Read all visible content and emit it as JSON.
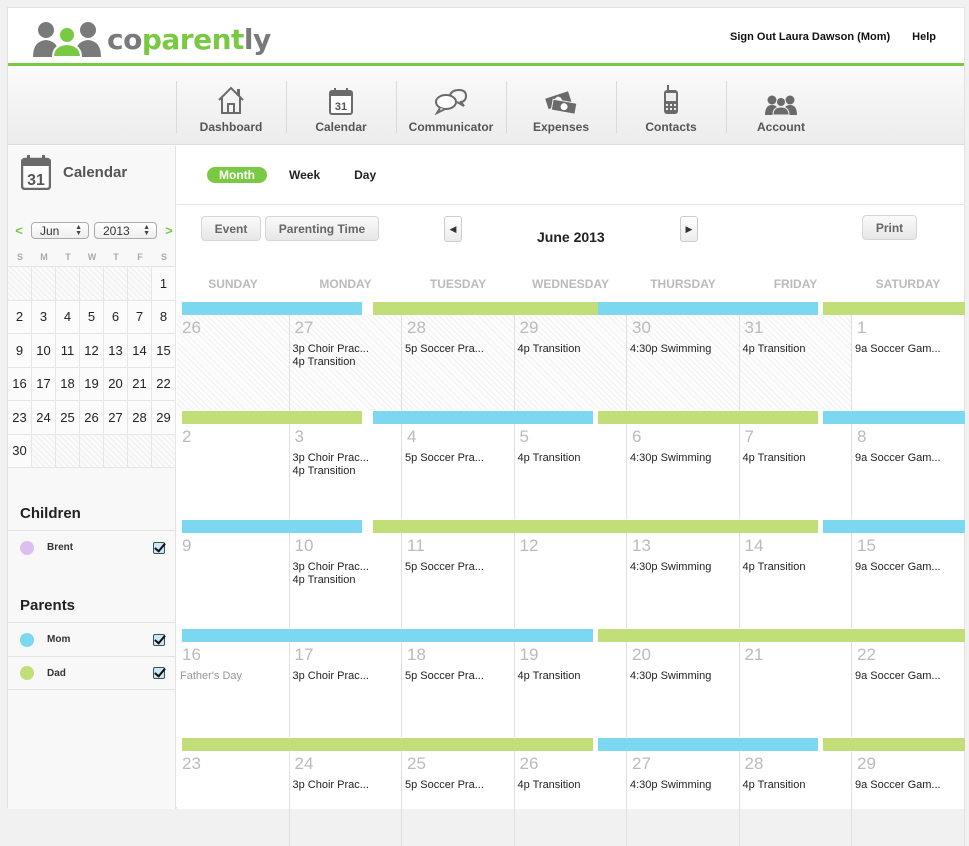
{
  "app": {
    "logo_part1": "co",
    "logo_part2": "parent",
    "logo_part3": "ly",
    "user_link": "Sign Out Laura Dawson (Mom)",
    "help_link": "Help"
  },
  "colors": {
    "brand_green": "#7ac943",
    "mom": "#7cd8f0",
    "dad": "#c2de78",
    "brent": "#dcbef0"
  },
  "nav": [
    {
      "label": "Dashboard",
      "icon": "house-icon"
    },
    {
      "label": "Calendar",
      "icon": "calendar-icon"
    },
    {
      "label": "Communicator",
      "icon": "speech-bubbles-icon"
    },
    {
      "label": "Expenses",
      "icon": "money-icon"
    },
    {
      "label": "Contacts",
      "icon": "phone-icon"
    },
    {
      "label": "Account",
      "icon": "people-icon"
    }
  ],
  "sidebar": {
    "title": "Calendar",
    "calendar_icon_day": "31",
    "prev": "<",
    "next": ">",
    "month_select": "Jun",
    "year_select": "2013",
    "dow": [
      "S",
      "M",
      "T",
      "W",
      "T",
      "F",
      "S"
    ],
    "mini_days": [
      "",
      "",
      "",
      "",
      "",
      "",
      "1",
      "2",
      "3",
      "4",
      "5",
      "6",
      "7",
      "8",
      "9",
      "10",
      "11",
      "12",
      "13",
      "14",
      "15",
      "16",
      "17",
      "18",
      "19",
      "20",
      "21",
      "22",
      "23",
      "24",
      "25",
      "26",
      "27",
      "28",
      "29",
      "30",
      "",
      "",
      "",
      "",
      "",
      ""
    ],
    "children_heading": "Children",
    "children": [
      {
        "name": "Brent",
        "color": "#dcbef0",
        "checked": true
      }
    ],
    "parents_heading": "Parents",
    "parents": [
      {
        "name": "Mom",
        "color": "#7cd8f0",
        "checked": true
      },
      {
        "name": "Dad",
        "color": "#c2de78",
        "checked": true
      }
    ]
  },
  "main": {
    "view_tabs": [
      "Month",
      "Week",
      "Day"
    ],
    "active_view": "Month",
    "event_button": "Event",
    "parenting_time_button": "Parenting Time",
    "month_title": "June 2013",
    "print_button": "Print",
    "weekdays": [
      "SUNDAY",
      "MONDAY",
      "TUESDAY",
      "WEDNESDAY",
      "THURSDAY",
      "FRIDAY",
      "SATURDAY"
    ],
    "weeks": [
      {
        "days": [
          {
            "n": "26",
            "out": true,
            "events": []
          },
          {
            "n": "27",
            "out": true,
            "events": [
              "3p Choir Prac...",
              "4p Transition"
            ]
          },
          {
            "n": "28",
            "out": true,
            "events": [
              "5p Soccer Pra..."
            ]
          },
          {
            "n": "29",
            "out": true,
            "events": [
              "4p Transition"
            ]
          },
          {
            "n": "30",
            "out": true,
            "events": [
              "4:30p Swimming"
            ]
          },
          {
            "n": "31",
            "out": true,
            "events": [
              "4p Transition"
            ]
          },
          {
            "n": "1",
            "out": false,
            "events": [
              "9a Soccer Gam..."
            ]
          }
        ],
        "custody": [
          {
            "parent": "mom",
            "from": 0,
            "to": 1.6
          },
          {
            "parent": "dad",
            "from": 1.7,
            "to": 3.7
          },
          {
            "parent": "mom",
            "from": 3.7,
            "to": 5.65
          },
          {
            "parent": "dad",
            "from": 5.7,
            "to": 7
          }
        ]
      },
      {
        "days": [
          {
            "n": "2",
            "out": false,
            "events": []
          },
          {
            "n": "3",
            "out": false,
            "events": [
              "3p Choir Prac...",
              "4p Transition"
            ]
          },
          {
            "n": "4",
            "out": false,
            "events": [
              "5p Soccer Pra..."
            ]
          },
          {
            "n": "5",
            "out": false,
            "events": [
              "4p Transition"
            ]
          },
          {
            "n": "6",
            "out": false,
            "events": [
              "4:30p Swimming"
            ]
          },
          {
            "n": "7",
            "out": false,
            "events": [
              "4p Transition"
            ]
          },
          {
            "n": "8",
            "out": false,
            "events": [
              "9a Soccer Gam..."
            ]
          }
        ],
        "custody": [
          {
            "parent": "dad",
            "from": 0,
            "to": 1.6
          },
          {
            "parent": "mom",
            "from": 1.7,
            "to": 3.65
          },
          {
            "parent": "dad",
            "from": 3.7,
            "to": 5.65
          },
          {
            "parent": "mom",
            "from": 5.7,
            "to": 7
          }
        ]
      },
      {
        "days": [
          {
            "n": "9",
            "out": false,
            "events": []
          },
          {
            "n": "10",
            "out": false,
            "events": [
              "3p Choir Prac...",
              "4p Transition"
            ]
          },
          {
            "n": "11",
            "out": false,
            "events": [
              "5p Soccer Pra..."
            ]
          },
          {
            "n": "12",
            "out": false,
            "events": []
          },
          {
            "n": "13",
            "out": false,
            "events": [
              "4:30p Swimming"
            ]
          },
          {
            "n": "14",
            "out": false,
            "events": [
              "4p Transition"
            ]
          },
          {
            "n": "15",
            "out": false,
            "events": [
              "9a Soccer Gam..."
            ]
          }
        ],
        "custody": [
          {
            "parent": "mom",
            "from": 0,
            "to": 1.6
          },
          {
            "parent": "dad",
            "from": 1.7,
            "to": 5.65
          },
          {
            "parent": "mom",
            "from": 5.7,
            "to": 7
          }
        ]
      },
      {
        "days": [
          {
            "n": "16",
            "out": false,
            "events": [],
            "note": "Father's Day"
          },
          {
            "n": "17",
            "out": false,
            "events": [
              "3p Choir Prac..."
            ]
          },
          {
            "n": "18",
            "out": false,
            "events": [
              "5p Soccer Pra..."
            ]
          },
          {
            "n": "19",
            "out": false,
            "events": [
              "4p Transition"
            ]
          },
          {
            "n": "20",
            "out": false,
            "events": [
              "4:30p Swimming"
            ]
          },
          {
            "n": "21",
            "out": false,
            "events": []
          },
          {
            "n": "22",
            "out": false,
            "events": [
              "9a Soccer Gam..."
            ]
          }
        ],
        "custody": [
          {
            "parent": "mom",
            "from": 0,
            "to": 3.65
          },
          {
            "parent": "dad",
            "from": 3.7,
            "to": 7
          }
        ]
      },
      {
        "days": [
          {
            "n": "23",
            "out": false,
            "events": []
          },
          {
            "n": "24",
            "out": false,
            "events": [
              "3p Choir Prac..."
            ]
          },
          {
            "n": "25",
            "out": false,
            "events": [
              "5p Soccer Pra..."
            ]
          },
          {
            "n": "26",
            "out": false,
            "events": [
              "4p Transition"
            ]
          },
          {
            "n": "27",
            "out": false,
            "events": [
              "4:30p Swimming"
            ]
          },
          {
            "n": "28",
            "out": false,
            "events": [
              "4p Transition"
            ]
          },
          {
            "n": "29",
            "out": false,
            "events": [
              "9a Soccer Gam..."
            ]
          }
        ],
        "custody": [
          {
            "parent": "dad",
            "from": 0,
            "to": 3.65
          },
          {
            "parent": "mom",
            "from": 3.7,
            "to": 5.65
          },
          {
            "parent": "dad",
            "from": 5.7,
            "to": 7
          }
        ]
      }
    ]
  }
}
